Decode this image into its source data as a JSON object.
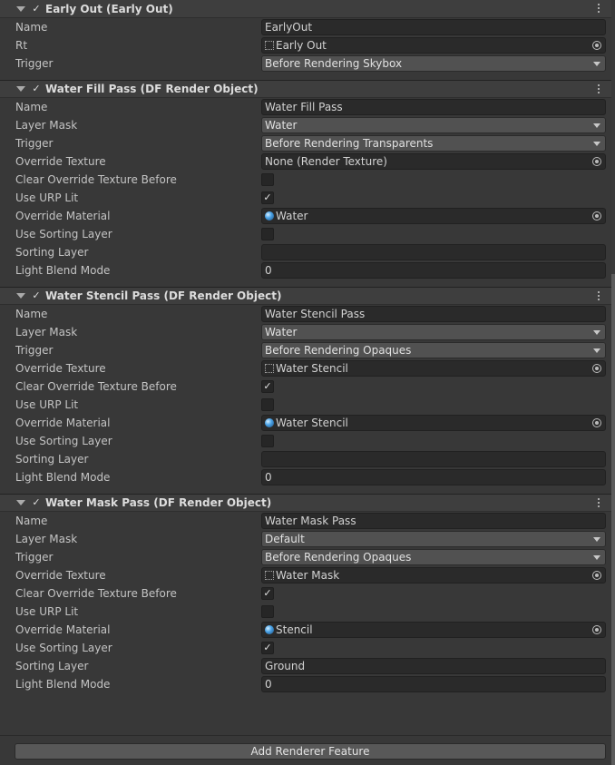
{
  "sections": [
    {
      "title": "Early Out (Early Out)",
      "enabled": true,
      "rows": [
        {
          "label": "Name",
          "type": "text",
          "value": "EarlyOut"
        },
        {
          "label": "Rt",
          "type": "object",
          "icon": "texture-icon",
          "value": "Early Out"
        },
        {
          "label": "Trigger",
          "type": "dropdown",
          "value": "Before Rendering Skybox"
        }
      ]
    },
    {
      "title": "Water Fill Pass (DF Render Object)",
      "enabled": true,
      "rows": [
        {
          "label": "Name",
          "type": "text",
          "value": "Water Fill Pass"
        },
        {
          "label": "Layer Mask",
          "type": "dropdown",
          "value": "Water"
        },
        {
          "label": "Trigger",
          "type": "dropdown",
          "value": "Before Rendering Transparents"
        },
        {
          "label": "Override Texture",
          "type": "object",
          "icon": "",
          "value": "None (Render Texture)"
        },
        {
          "label": "Clear Override Texture Before",
          "type": "toggle",
          "checked": false
        },
        {
          "label": "Use URP Lit",
          "type": "toggle",
          "checked": true
        },
        {
          "label": "Override Material",
          "type": "object",
          "icon": "material-icon",
          "value": "Water"
        },
        {
          "label": "Use Sorting Layer",
          "type": "toggle",
          "checked": false
        },
        {
          "label": "Sorting Layer",
          "type": "text",
          "value": ""
        },
        {
          "label": "Light Blend Mode",
          "type": "text",
          "value": "0"
        }
      ]
    },
    {
      "title": "Water Stencil Pass (DF Render Object)",
      "enabled": true,
      "rows": [
        {
          "label": "Name",
          "type": "text",
          "value": "Water Stencil Pass"
        },
        {
          "label": "Layer Mask",
          "type": "dropdown",
          "value": "Water"
        },
        {
          "label": "Trigger",
          "type": "dropdown",
          "value": "Before Rendering Opaques"
        },
        {
          "label": "Override Texture",
          "type": "object",
          "icon": "texture-icon",
          "value": "Water Stencil"
        },
        {
          "label": "Clear Override Texture Before",
          "type": "toggle",
          "checked": true
        },
        {
          "label": "Use URP Lit",
          "type": "toggle",
          "checked": false
        },
        {
          "label": "Override Material",
          "type": "object",
          "icon": "material-icon",
          "value": "Water Stencil"
        },
        {
          "label": "Use Sorting Layer",
          "type": "toggle",
          "checked": false
        },
        {
          "label": "Sorting Layer",
          "type": "text",
          "value": ""
        },
        {
          "label": "Light Blend Mode",
          "type": "text",
          "value": "0"
        }
      ]
    },
    {
      "title": "Water Mask Pass (DF Render Object)",
      "enabled": true,
      "rows": [
        {
          "label": "Name",
          "type": "text",
          "value": "Water Mask Pass"
        },
        {
          "label": "Layer Mask",
          "type": "dropdown",
          "value": "Default"
        },
        {
          "label": "Trigger",
          "type": "dropdown",
          "value": "Before Rendering Opaques"
        },
        {
          "label": "Override Texture",
          "type": "object",
          "icon": "texture-icon",
          "value": "Water Mask"
        },
        {
          "label": "Clear Override Texture Before",
          "type": "toggle",
          "checked": true
        },
        {
          "label": "Use URP Lit",
          "type": "toggle",
          "checked": false
        },
        {
          "label": "Override Material",
          "type": "object",
          "icon": "material-icon",
          "value": "Stencil"
        },
        {
          "label": "Use Sorting Layer",
          "type": "toggle",
          "checked": true
        },
        {
          "label": "Sorting Layer",
          "type": "text",
          "value": "Ground"
        },
        {
          "label": "Light Blend Mode",
          "type": "text",
          "value": "0"
        }
      ]
    }
  ],
  "add_button_label": "Add Renderer Feature",
  "check_glyph": "✓"
}
